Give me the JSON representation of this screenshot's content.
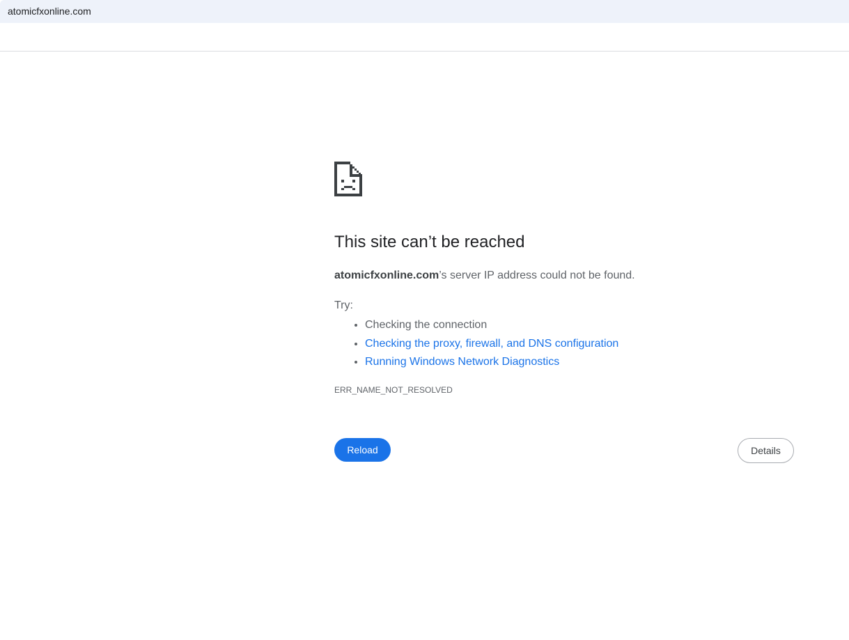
{
  "address_bar": {
    "url": "atomicfxonline.com"
  },
  "error": {
    "icon": "sad-page-icon",
    "title": "This site can’t be reached",
    "host": "atomicfxonline.com",
    "message_suffix": "’s server IP address could not be found.",
    "try_label": "Try:",
    "suggestions": [
      {
        "text": "Checking the connection",
        "link": false
      },
      {
        "text": "Checking the proxy, firewall, and DNS configuration",
        "link": true
      },
      {
        "text": "Running Windows Network Diagnostics",
        "link": true
      }
    ],
    "code": "ERR_NAME_NOT_RESOLVED"
  },
  "buttons": {
    "reload_label": "Reload",
    "details_label": "Details"
  },
  "colors": {
    "accent": "#1a73e8",
    "text_primary": "#202124",
    "text_secondary": "#5f6368",
    "address_bar_bg": "#eef2fa"
  }
}
